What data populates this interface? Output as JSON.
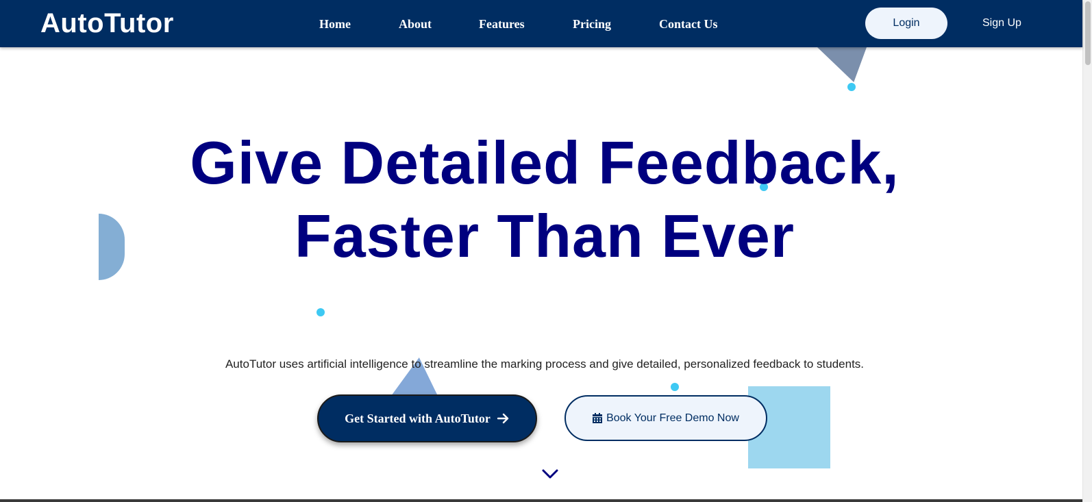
{
  "header": {
    "logo": "AutoTutor",
    "nav": [
      {
        "label": "Home"
      },
      {
        "label": "About"
      },
      {
        "label": "Features"
      },
      {
        "label": "Pricing"
      },
      {
        "label": "Contact Us"
      }
    ],
    "login_label": "Login",
    "signup_label": "Sign Up"
  },
  "hero": {
    "title": "Give Detailed Feedback, Faster Than Ever",
    "subtitle": "AutoTutor uses artificial intelligence to streamline the marking process and give detailed, personalized feedback to students.",
    "primary_cta": "Get Started with AutoTutor",
    "primary_cta_icon": "arrow-right-icon",
    "secondary_cta": "Book Your Free Demo Now",
    "secondary_cta_icon": "calendar-icon",
    "scroll_icon": "chevron-down-icon"
  },
  "colors": {
    "navbar": "#002d62",
    "title": "#00007f",
    "accent_dot": "#3ec9f3",
    "button_light": "#eef4fc",
    "deco_square": "#9dd7ef"
  }
}
